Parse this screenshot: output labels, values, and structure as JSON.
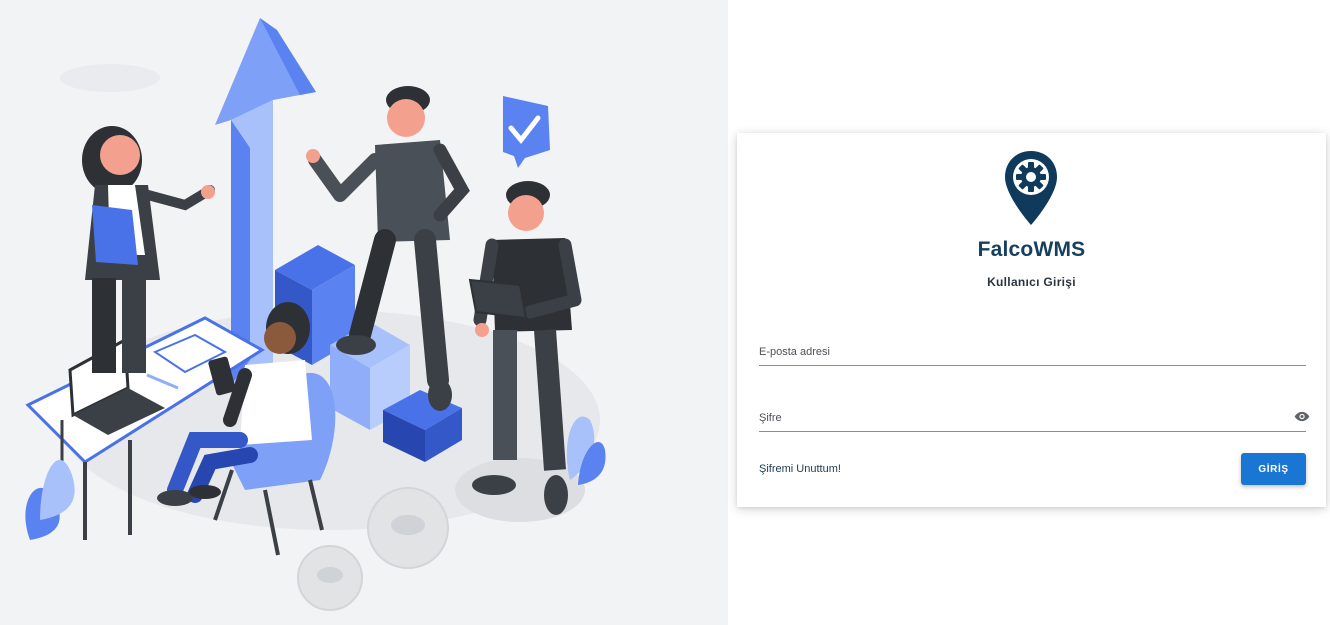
{
  "brand": {
    "name": "FalcoWMS",
    "color": "#17405f",
    "logo_icon": "map-pin-gear-icon"
  },
  "login": {
    "subtitle": "Kullanıcı Girişi",
    "email_placeholder": "E-posta adresi",
    "password_placeholder": "Şifre",
    "show_password_icon": "eye-icon",
    "forgot_password_label": "Şifremi Unuttum!",
    "submit_label": "GİRİŞ",
    "submit_color": "#1976d2"
  },
  "illustration": {
    "accent_color": "#5a82f0",
    "dark_color": "#3b4046",
    "skin_color": "#f4a08f"
  }
}
